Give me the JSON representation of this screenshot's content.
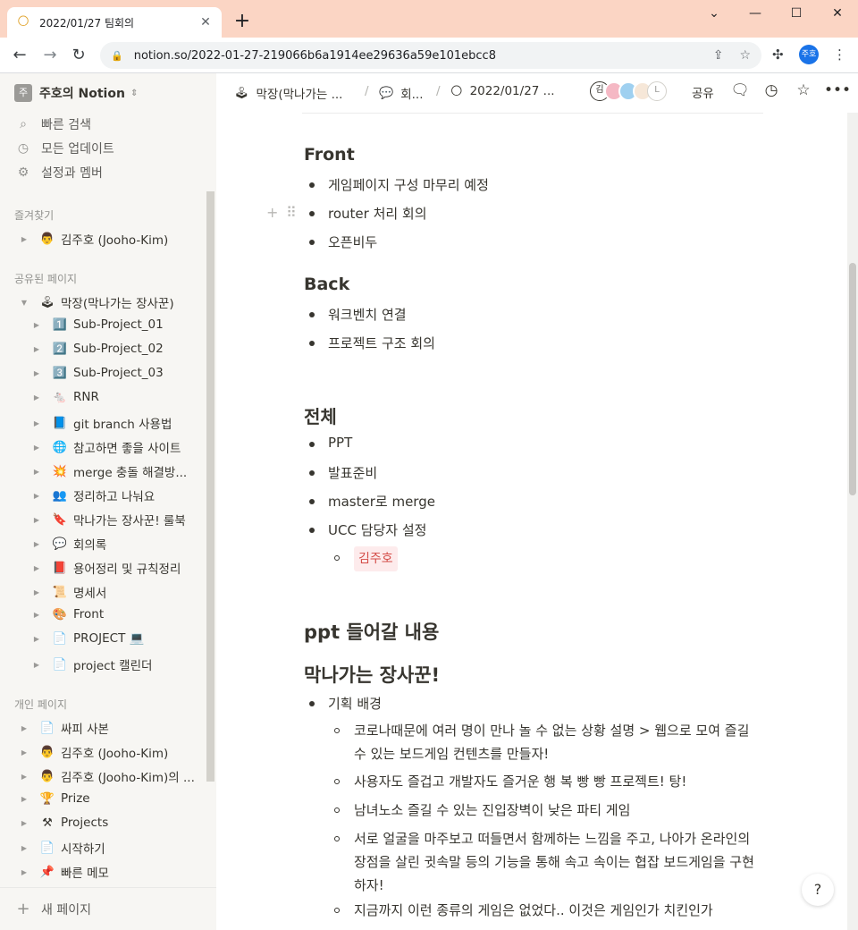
{
  "browser": {
    "tab_title": "2022/01/27 팀회의",
    "tab_icon": "🌕",
    "url": "notion.so/2022-01-27-219066b6a1914ee29636a59e101ebcc8",
    "profile_initials": "주호"
  },
  "sidebar": {
    "workspace": "주호의 Notion",
    "workspace_icon": "주",
    "actions": [
      {
        "icon": "search-icon",
        "label": "빠른 검색"
      },
      {
        "icon": "clock-icon",
        "label": "모든 업데이트"
      },
      {
        "icon": "gear-icon",
        "label": "설정과 멤버"
      }
    ],
    "favorites_title": "즐겨찾기",
    "favorites": [
      {
        "icon": "👨",
        "label": "김주호 (Jooho-Kim)"
      }
    ],
    "shared_title": "공유된 페이지",
    "shared_root": {
      "icon": "🕹",
      "label": "막장(막나가는 장사꾼)"
    },
    "shared_children": [
      {
        "icon": "1️⃣",
        "label": "Sub-Project_01"
      },
      {
        "icon": "2️⃣",
        "label": "Sub-Project_02"
      },
      {
        "icon": "3️⃣",
        "label": "Sub-Project_03"
      },
      {
        "icon": "🐁",
        "label": "RNR"
      },
      {
        "icon": "📘",
        "label": "git branch 사용법"
      },
      {
        "icon": "🌐",
        "label": "참고하면 좋을 사이트"
      },
      {
        "icon": "💥",
        "label": "merge 충돌 해결방..."
      },
      {
        "icon": "👥",
        "label": "정리하고 나눠요"
      },
      {
        "icon": "🔖",
        "label": "막나가는 장사꾼! 룰북"
      },
      {
        "icon": "💬",
        "label": "회의록"
      },
      {
        "icon": "📕",
        "label": "용어정리 및 규칙정리"
      },
      {
        "icon": "📜",
        "label": "명세서"
      },
      {
        "icon": "🎨",
        "label": "Front"
      },
      {
        "icon": "📄",
        "label": "PROJECT 💻"
      },
      {
        "icon": "📄",
        "label": "project 캘린더"
      }
    ],
    "private_title": "개인 페이지",
    "private": [
      {
        "icon": "📄",
        "label": "싸피 사본"
      },
      {
        "icon": "👨",
        "label": "김주호 (Jooho-Kim)"
      },
      {
        "icon": "👨",
        "label": "김주호 (Jooho-Kim)의 ..."
      },
      {
        "icon": "🏆",
        "label": "Prize"
      },
      {
        "icon": "⚒",
        "label": "Projects"
      },
      {
        "icon": "📄",
        "label": "시작하기"
      },
      {
        "icon": "📌",
        "label": "빠른 메모"
      }
    ],
    "new_page": "새 페이지"
  },
  "topbar": {
    "crumbs": [
      {
        "icon": "🕹",
        "label": "막장(막나가는 ..."
      },
      {
        "icon": "💬",
        "label": "회..."
      },
      {
        "icon": "🌕",
        "label": "2022/01/27 ..."
      }
    ],
    "avatars": [
      "김",
      "",
      "",
      "",
      "L"
    ],
    "share_label": "공유"
  },
  "content": {
    "front_heading": "Front",
    "front_items": [
      "게임페이지 구성 마무리 예정",
      "router 처리 회의",
      "오픈비두"
    ],
    "back_heading": "Back",
    "back_items": [
      "워크벤치 연결",
      "프로젝트 구조 회의"
    ],
    "all_heading": "전체",
    "all_items": [
      "PPT",
      "발표준비",
      "master로 merge",
      "UCC 담당자 설정"
    ],
    "ucc_tag": "김주호",
    "ppt_heading": "ppt 들어갈 내용",
    "game_heading": "막나가는 장사꾼!",
    "plan_item": "기획 배경",
    "plan_subs": [
      "코로나때문에 여러 명이 만나 놀 수 없는 상황 설명 > 웹으로 모여 즐길 수 있는 보드게임 컨텐츠를 만들자!",
      "사용자도 즐겁고 개발자도 즐거운 행 복 빵 빵 프로젝트! 탕!",
      "남녀노소 즐길 수 있는 진입장벽이 낮은 파티 게임",
      "서로 얼굴을 마주보고 떠들면서 함께하는 느낌을 주고, 나아가 온라인의 장점을 살린 귓속말 등의 기능을 통해 속고 속이는 협잡 보드게임을 구현하자!",
      "지금까지 이런 종류의 게임은 없었다.. 이것은 게임인가 치킨인가"
    ]
  },
  "help_label": "?"
}
